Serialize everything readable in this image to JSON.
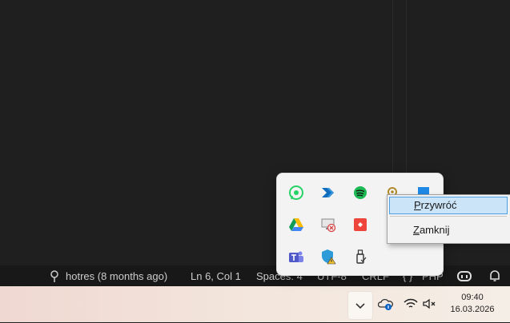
{
  "statusbar": {
    "git_blame": "hotres (8 months ago)",
    "cursor": "Ln 6, Col 1",
    "spaces": "Spaces: 4",
    "encoding": "UTF-8",
    "eol": "CRLF",
    "language": "PHP"
  },
  "tray_flyout": {
    "icons": [
      "whatsapp-icon",
      "power-automate-icon",
      "spotify-icon",
      "location-pin-icon",
      "blue-app-icon",
      "google-drive-icon",
      "remote-desktop-disconnected-icon",
      "anydesk-icon",
      "teams-icon",
      "defender-warning-icon",
      "usb-drive-icon"
    ]
  },
  "context_menu": {
    "restore": {
      "first": "P",
      "rest": "rzywróć"
    },
    "close": {
      "first": "Z",
      "rest": "amknij"
    }
  },
  "clock": {
    "time": "09:40",
    "date": "16.03.2026"
  },
  "colors": {
    "accent_menu_hover": "#cce4f7",
    "statusbar_bg": "#181818",
    "editor_bg": "#1f1f1f"
  }
}
